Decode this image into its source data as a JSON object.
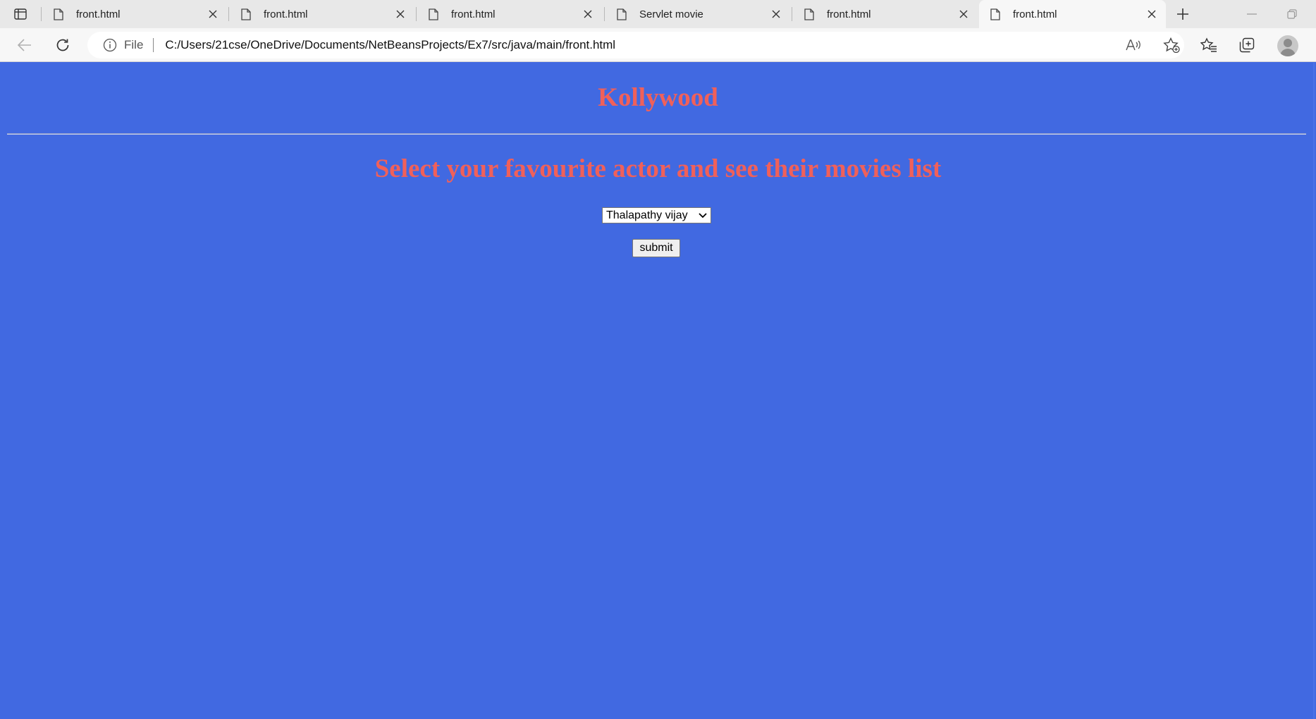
{
  "browser": {
    "tabs": [
      {
        "label": "front.html",
        "active": false
      },
      {
        "label": "front.html",
        "active": false
      },
      {
        "label": "front.html",
        "active": false
      },
      {
        "label": "Servlet movie",
        "active": false
      },
      {
        "label": "front.html",
        "active": false
      },
      {
        "label": "front.html",
        "active": true
      }
    ],
    "address": {
      "scheme_label": "File",
      "url": "C:/Users/21cse/OneDrive/Documents/NetBeansProjects/Ex7/src/java/main/front.html"
    },
    "icons": {
      "tab_actions": "tab-actions-icon",
      "tab_page": "document-icon",
      "tab_close": "close-icon",
      "new_tab": "plus-icon",
      "minimize": "minimize-icon",
      "restore": "restore-icon",
      "back": "back-arrow-icon",
      "refresh": "refresh-icon",
      "site_info": "info-icon",
      "read_aloud": "read-aloud-icon",
      "add_favorite": "add-favorite-icon",
      "favorites": "favorites-icon",
      "collections": "collections-icon",
      "profile": "profile-avatar"
    }
  },
  "page": {
    "title": "Kollywood",
    "subtitle": "Select your favourite actor and see their movies list",
    "actor_select": {
      "selected": "Thalapathy vijay"
    },
    "submit_label": "submit"
  },
  "colors": {
    "page_background": "#4169e1",
    "heading": "#f0605a",
    "chrome_tabbar": "#e8e8e8",
    "chrome_toolbar": "#f7f7f7"
  }
}
